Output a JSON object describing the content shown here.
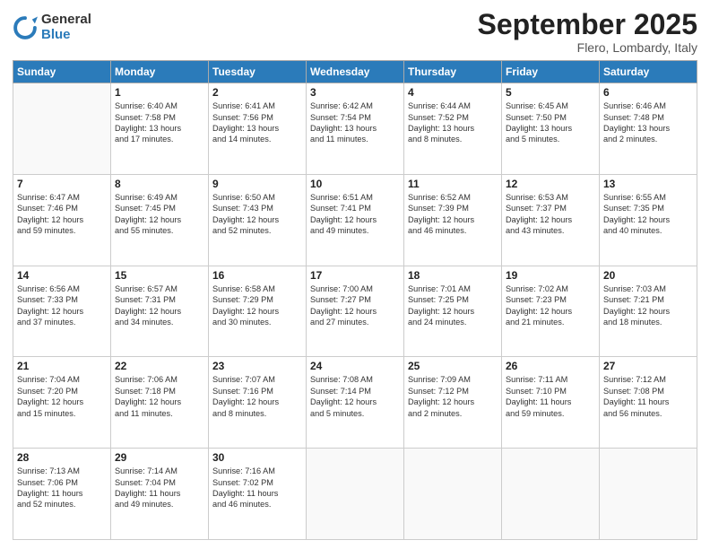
{
  "logo": {
    "general": "General",
    "blue": "Blue"
  },
  "header": {
    "month": "September 2025",
    "location": "Flero, Lombardy, Italy"
  },
  "days": [
    "Sunday",
    "Monday",
    "Tuesday",
    "Wednesday",
    "Thursday",
    "Friday",
    "Saturday"
  ],
  "weeks": [
    [
      {
        "num": "",
        "lines": []
      },
      {
        "num": "1",
        "lines": [
          "Sunrise: 6:40 AM",
          "Sunset: 7:58 PM",
          "Daylight: 13 hours",
          "and 17 minutes."
        ]
      },
      {
        "num": "2",
        "lines": [
          "Sunrise: 6:41 AM",
          "Sunset: 7:56 PM",
          "Daylight: 13 hours",
          "and 14 minutes."
        ]
      },
      {
        "num": "3",
        "lines": [
          "Sunrise: 6:42 AM",
          "Sunset: 7:54 PM",
          "Daylight: 13 hours",
          "and 11 minutes."
        ]
      },
      {
        "num": "4",
        "lines": [
          "Sunrise: 6:44 AM",
          "Sunset: 7:52 PM",
          "Daylight: 13 hours",
          "and 8 minutes."
        ]
      },
      {
        "num": "5",
        "lines": [
          "Sunrise: 6:45 AM",
          "Sunset: 7:50 PM",
          "Daylight: 13 hours",
          "and 5 minutes."
        ]
      },
      {
        "num": "6",
        "lines": [
          "Sunrise: 6:46 AM",
          "Sunset: 7:48 PM",
          "Daylight: 13 hours",
          "and 2 minutes."
        ]
      }
    ],
    [
      {
        "num": "7",
        "lines": [
          "Sunrise: 6:47 AM",
          "Sunset: 7:46 PM",
          "Daylight: 12 hours",
          "and 59 minutes."
        ]
      },
      {
        "num": "8",
        "lines": [
          "Sunrise: 6:49 AM",
          "Sunset: 7:45 PM",
          "Daylight: 12 hours",
          "and 55 minutes."
        ]
      },
      {
        "num": "9",
        "lines": [
          "Sunrise: 6:50 AM",
          "Sunset: 7:43 PM",
          "Daylight: 12 hours",
          "and 52 minutes."
        ]
      },
      {
        "num": "10",
        "lines": [
          "Sunrise: 6:51 AM",
          "Sunset: 7:41 PM",
          "Daylight: 12 hours",
          "and 49 minutes."
        ]
      },
      {
        "num": "11",
        "lines": [
          "Sunrise: 6:52 AM",
          "Sunset: 7:39 PM",
          "Daylight: 12 hours",
          "and 46 minutes."
        ]
      },
      {
        "num": "12",
        "lines": [
          "Sunrise: 6:53 AM",
          "Sunset: 7:37 PM",
          "Daylight: 12 hours",
          "and 43 minutes."
        ]
      },
      {
        "num": "13",
        "lines": [
          "Sunrise: 6:55 AM",
          "Sunset: 7:35 PM",
          "Daylight: 12 hours",
          "and 40 minutes."
        ]
      }
    ],
    [
      {
        "num": "14",
        "lines": [
          "Sunrise: 6:56 AM",
          "Sunset: 7:33 PM",
          "Daylight: 12 hours",
          "and 37 minutes."
        ]
      },
      {
        "num": "15",
        "lines": [
          "Sunrise: 6:57 AM",
          "Sunset: 7:31 PM",
          "Daylight: 12 hours",
          "and 34 minutes."
        ]
      },
      {
        "num": "16",
        "lines": [
          "Sunrise: 6:58 AM",
          "Sunset: 7:29 PM",
          "Daylight: 12 hours",
          "and 30 minutes."
        ]
      },
      {
        "num": "17",
        "lines": [
          "Sunrise: 7:00 AM",
          "Sunset: 7:27 PM",
          "Daylight: 12 hours",
          "and 27 minutes."
        ]
      },
      {
        "num": "18",
        "lines": [
          "Sunrise: 7:01 AM",
          "Sunset: 7:25 PM",
          "Daylight: 12 hours",
          "and 24 minutes."
        ]
      },
      {
        "num": "19",
        "lines": [
          "Sunrise: 7:02 AM",
          "Sunset: 7:23 PM",
          "Daylight: 12 hours",
          "and 21 minutes."
        ]
      },
      {
        "num": "20",
        "lines": [
          "Sunrise: 7:03 AM",
          "Sunset: 7:21 PM",
          "Daylight: 12 hours",
          "and 18 minutes."
        ]
      }
    ],
    [
      {
        "num": "21",
        "lines": [
          "Sunrise: 7:04 AM",
          "Sunset: 7:20 PM",
          "Daylight: 12 hours",
          "and 15 minutes."
        ]
      },
      {
        "num": "22",
        "lines": [
          "Sunrise: 7:06 AM",
          "Sunset: 7:18 PM",
          "Daylight: 12 hours",
          "and 11 minutes."
        ]
      },
      {
        "num": "23",
        "lines": [
          "Sunrise: 7:07 AM",
          "Sunset: 7:16 PM",
          "Daylight: 12 hours",
          "and 8 minutes."
        ]
      },
      {
        "num": "24",
        "lines": [
          "Sunrise: 7:08 AM",
          "Sunset: 7:14 PM",
          "Daylight: 12 hours",
          "and 5 minutes."
        ]
      },
      {
        "num": "25",
        "lines": [
          "Sunrise: 7:09 AM",
          "Sunset: 7:12 PM",
          "Daylight: 12 hours",
          "and 2 minutes."
        ]
      },
      {
        "num": "26",
        "lines": [
          "Sunrise: 7:11 AM",
          "Sunset: 7:10 PM",
          "Daylight: 11 hours",
          "and 59 minutes."
        ]
      },
      {
        "num": "27",
        "lines": [
          "Sunrise: 7:12 AM",
          "Sunset: 7:08 PM",
          "Daylight: 11 hours",
          "and 56 minutes."
        ]
      }
    ],
    [
      {
        "num": "28",
        "lines": [
          "Sunrise: 7:13 AM",
          "Sunset: 7:06 PM",
          "Daylight: 11 hours",
          "and 52 minutes."
        ]
      },
      {
        "num": "29",
        "lines": [
          "Sunrise: 7:14 AM",
          "Sunset: 7:04 PM",
          "Daylight: 11 hours",
          "and 49 minutes."
        ]
      },
      {
        "num": "30",
        "lines": [
          "Sunrise: 7:16 AM",
          "Sunset: 7:02 PM",
          "Daylight: 11 hours",
          "and 46 minutes."
        ]
      },
      {
        "num": "",
        "lines": []
      },
      {
        "num": "",
        "lines": []
      },
      {
        "num": "",
        "lines": []
      },
      {
        "num": "",
        "lines": []
      }
    ]
  ]
}
